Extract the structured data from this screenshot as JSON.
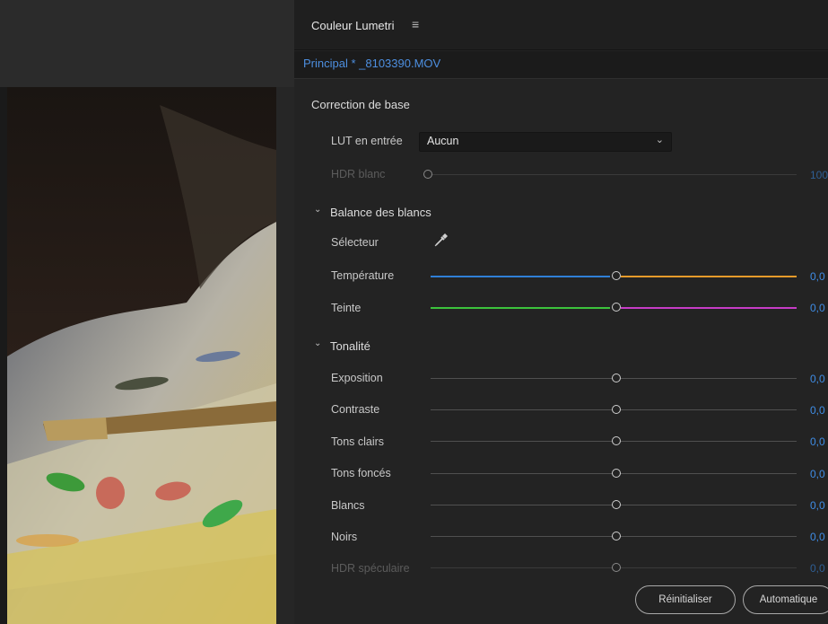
{
  "panel": {
    "title": "Couleur Lumetri",
    "menu_glyph": "≡",
    "clip_label": "Principal * _8103390.MOV"
  },
  "basic_correction": {
    "title": "Correction de base",
    "lut_label": "LUT en entrée",
    "lut_value": "Aucun",
    "hdr_white_label": "HDR blanc",
    "hdr_white_value": "100"
  },
  "white_balance": {
    "title": "Balance des blancs",
    "selector_label": "Sélecteur",
    "temperature_label": "Température",
    "temperature_value": "0,0",
    "tint_label": "Teinte",
    "tint_value": "0,0"
  },
  "tone": {
    "title": "Tonalité",
    "exposure_label": "Exposition",
    "exposure_value": "0,0",
    "contrast_label": "Contraste",
    "contrast_value": "0,0",
    "highlights_label": "Tons clairs",
    "highlights_value": "0,0",
    "shadows_label": "Tons foncés",
    "shadows_value": "0,0",
    "whites_label": "Blancs",
    "whites_value": "0,0",
    "blacks_label": "Noirs",
    "blacks_value": "0,0",
    "hdr_specular_label": "HDR spéculaire",
    "hdr_specular_value": "0,0"
  },
  "buttons": {
    "reset": "Réinitialiser",
    "auto": "Automatique"
  },
  "colors": {
    "accent": "#3f8de6",
    "temperature_cold": "#2f7fd6",
    "temperature_warm": "#e59a2a",
    "tint_green": "#3cc33c",
    "tint_magenta": "#c63cc6"
  }
}
